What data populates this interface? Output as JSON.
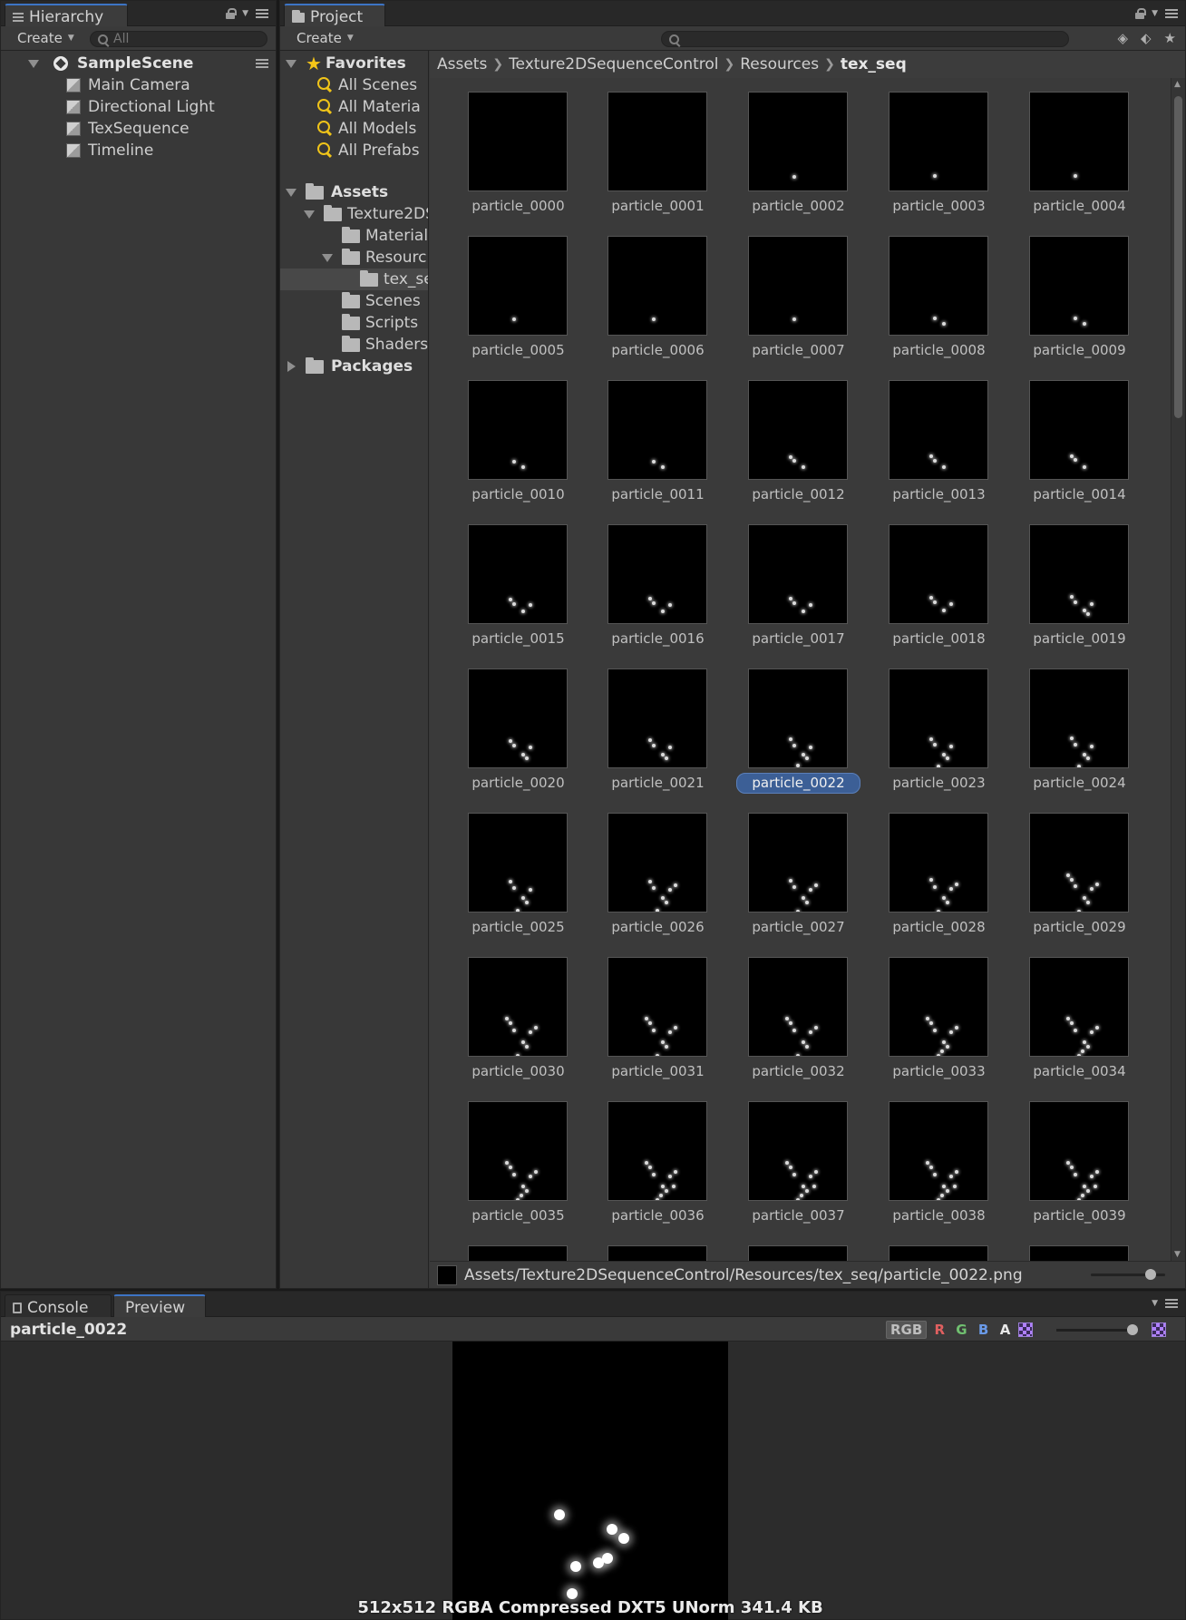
{
  "hierarchy": {
    "tab_label": "Hierarchy",
    "create_label": "Create",
    "search_placeholder": "All",
    "scene": "SampleScene",
    "objects": [
      "Main Camera",
      "Directional Light",
      "TexSequence",
      "Timeline"
    ]
  },
  "project": {
    "tab_label": "Project",
    "create_label": "Create",
    "favorites_label": "Favorites",
    "favorites": [
      "All Scenes",
      "All Materia",
      "All Models",
      "All Prefabs"
    ],
    "assets_label": "Assets",
    "assets_tree": [
      {
        "label": "Texture2DS",
        "depth": 1,
        "expanded": true
      },
      {
        "label": "Materials",
        "depth": 2
      },
      {
        "label": "Resourc",
        "depth": 2,
        "expanded": true
      },
      {
        "label": "tex_se",
        "depth": 3,
        "selected": true
      },
      {
        "label": "Scenes",
        "depth": 2
      },
      {
        "label": "Scripts",
        "depth": 2
      },
      {
        "label": "Shaders",
        "depth": 2
      }
    ],
    "packages_label": "Packages",
    "breadcrumb": [
      "Assets",
      "Texture2DSequenceControl",
      "Resources",
      "tex_seq"
    ],
    "assets": [
      "particle_0000",
      "particle_0001",
      "particle_0002",
      "particle_0003",
      "particle_0004",
      "particle_0005",
      "particle_0006",
      "particle_0007",
      "particle_0008",
      "particle_0009",
      "particle_0010",
      "particle_0011",
      "particle_0012",
      "particle_0013",
      "particle_0014",
      "particle_0015",
      "particle_0016",
      "particle_0017",
      "particle_0018",
      "particle_0019",
      "particle_0020",
      "particle_0021",
      "particle_0022",
      "particle_0023",
      "particle_0024",
      "particle_0025",
      "particle_0026",
      "particle_0027",
      "particle_0028",
      "particle_0029",
      "particle_0030",
      "particle_0031",
      "particle_0032",
      "particle_0033",
      "particle_0034",
      "particle_0035",
      "particle_0036",
      "particle_0037",
      "particle_0038",
      "particle_0039"
    ],
    "selected_asset": "particle_0022",
    "selected_path": "Assets/Texture2DSequenceControl/Resources/tex_seq/particle_0022.png"
  },
  "bottom": {
    "console_tab": "Console",
    "preview_tab": "Preview",
    "preview_title": "particle_0022",
    "channels": [
      "RGB",
      "R",
      "G",
      "B",
      "A"
    ],
    "channel_colors": {
      "RGB": "#bdbdbd",
      "R": "#e06060",
      "G": "#70c070",
      "B": "#6a9ae8",
      "A": "#e8e8e8"
    },
    "info": "512x512  RGBA Compressed DXT5 UNorm   341.4 KB"
  },
  "colors": {
    "selection": "#3c5f96",
    "favorite_icon": "#f0c419",
    "tab_accent": "#3d74c5"
  }
}
